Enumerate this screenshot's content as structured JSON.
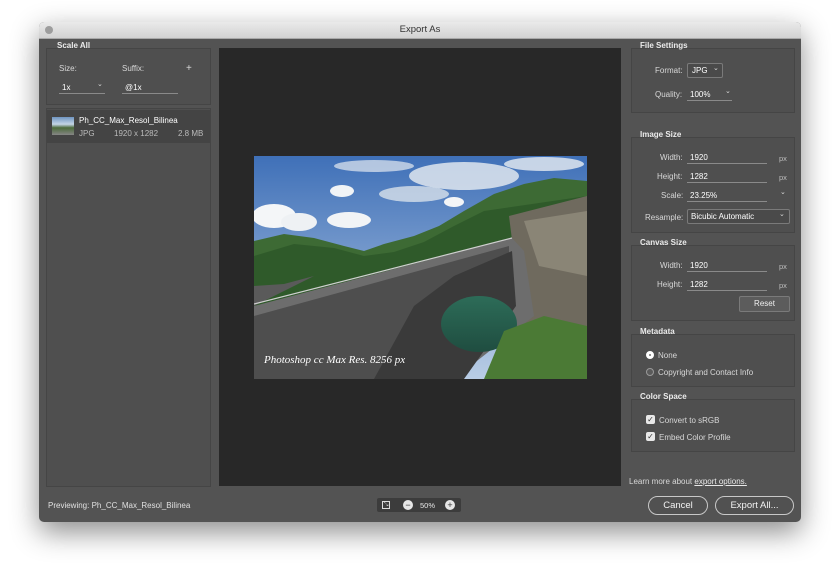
{
  "window": {
    "title": "Export As"
  },
  "scale_all": {
    "title": "Scale All",
    "size_label": "Size:",
    "suffix_label": "Suffix:",
    "size_value": "1x",
    "suffix_value": "@1x",
    "add_icon": "+"
  },
  "asset": {
    "name": "Ph_CC_Max_Resol_Bilinea",
    "format": "JPG",
    "dimensions": "1920 x 1282",
    "filesize": "2.8 MB"
  },
  "previewing": {
    "label": "Previewing:",
    "name": "Ph_CC_Max_Resol_Bilinea"
  },
  "watermark": "Photoshop cc Max Res. 8256 px",
  "zoom": {
    "level": "50%",
    "minus": "−",
    "plus": "+"
  },
  "file_settings": {
    "title": "File Settings",
    "format_label": "Format:",
    "format_value": "JPG",
    "quality_label": "Quality:",
    "quality_value": "100%"
  },
  "image_size": {
    "title": "Image Size",
    "width_label": "Width:",
    "width_value": "1920",
    "height_label": "Height:",
    "height_value": "1282",
    "scale_label": "Scale:",
    "scale_value": "23.25%",
    "resample_label": "Resample:",
    "resample_value": "Bicubic Automatic",
    "unit": "px"
  },
  "canvas_size": {
    "title": "Canvas Size",
    "width_label": "Width:",
    "width_value": "1920",
    "height_label": "Height:",
    "height_value": "1282",
    "unit": "px",
    "reset_label": "Reset"
  },
  "metadata": {
    "title": "Metadata",
    "option_none": "None",
    "option_copyright": "Copyright and Contact Info",
    "selected": "None"
  },
  "color_space": {
    "title": "Color Space",
    "convert_label": "Convert to sRGB",
    "convert_checked": true,
    "embed_label": "Embed Color Profile",
    "embed_checked": true
  },
  "footer": {
    "learn_more": "Learn more about",
    "learn_link": "export options.",
    "cancel_label": "Cancel",
    "export_label": "Export All..."
  },
  "colors": {
    "window_bg": "#535353",
    "preview_bg": "#282828",
    "selected_asset": "#444444"
  }
}
